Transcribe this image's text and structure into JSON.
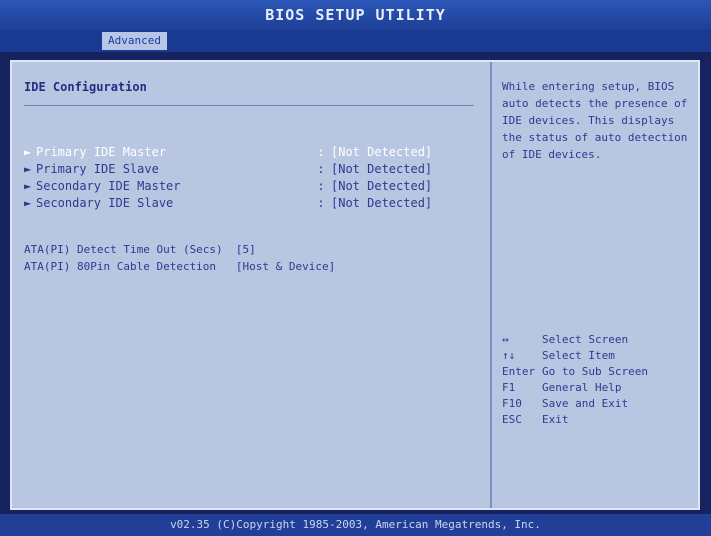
{
  "window": {
    "title": "BIOS SETUP UTILITY"
  },
  "tabs": [
    {
      "label": "Advanced",
      "active": true
    }
  ],
  "main": {
    "section_title": "IDE Configuration",
    "items": [
      {
        "label": "Primary IDE Master",
        "value": "[Not Detected]"
      },
      {
        "label": "Primary IDE Slave",
        "value": "[Not Detected]"
      },
      {
        "label": "Secondary IDE Master",
        "value": "[Not Detected]"
      },
      {
        "label": "Secondary IDE Slave",
        "value": "[Not Detected]"
      }
    ],
    "arrow_glyph": "►",
    "separator": ":",
    "misc": [
      "ATA(PI) Detect Time Out (Secs)  [5]",
      "ATA(PI) 80Pin Cable Detection   [Host & Device]"
    ]
  },
  "help": {
    "text": "While entering setup, BIOS auto detects the presence of IDE devices. This displays the status of auto detection of IDE devices.",
    "keys": [
      {
        "key": "↔",
        "desc": "Select Screen"
      },
      {
        "key": "↑↓",
        "desc": "Select Item"
      },
      {
        "key": "Enter",
        "desc": "Go to Sub Screen"
      },
      {
        "key": "F1",
        "desc": "General Help"
      },
      {
        "key": "F10",
        "desc": "Save and Exit"
      },
      {
        "key": "ESC",
        "desc": "Exit"
      }
    ]
  },
  "footer": {
    "text": "v02.35 (C)Copyright 1985-2003, American Megatrends, Inc."
  },
  "colors": {
    "background": "#17235f",
    "panel": "#b9c6e2",
    "text": "#2a3b91",
    "selected": "#ffffff"
  }
}
